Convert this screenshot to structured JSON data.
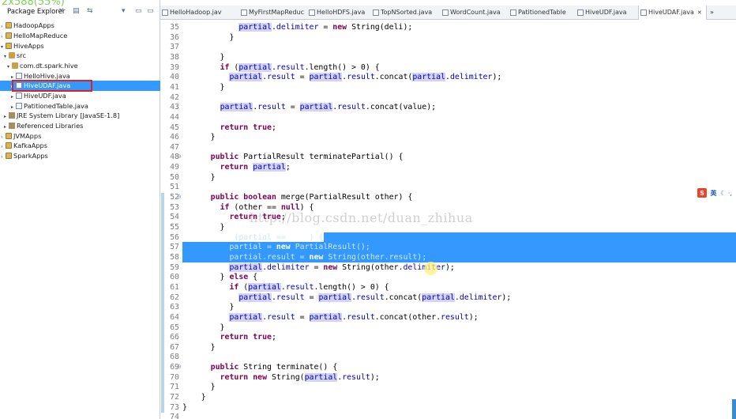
{
  "overlay": {
    "size_label": "2x588(55%)"
  },
  "explorer": {
    "title": "Package Explorer",
    "close": "✕",
    "toolbar": [
      "▤",
      "⇆",
      "▾",
      "▭",
      "▭"
    ],
    "items": [
      {
        "label": "HadoopApps",
        "kind": "project"
      },
      {
        "label": "HelloMapReduce",
        "kind": "project"
      },
      {
        "label": "HiveApps",
        "kind": "project"
      },
      {
        "label": "src",
        "kind": "src"
      },
      {
        "label": "com.dt.spark.hive",
        "kind": "package"
      },
      {
        "label": "HelloHive.java",
        "kind": "java"
      },
      {
        "label": "HiveUDAF.java",
        "kind": "java"
      },
      {
        "label": "HiveUDF.java",
        "kind": "java"
      },
      {
        "label": "PatitionedTable.java",
        "kind": "java"
      },
      {
        "label": "JRE System Library [JavaSE-1.8]",
        "kind": "lib"
      },
      {
        "label": "Referenced Libraries",
        "kind": "lib"
      },
      {
        "label": "JVMApps",
        "kind": "project"
      },
      {
        "label": "KafkaApps",
        "kind": "project"
      },
      {
        "label": "SparkApps",
        "kind": "project"
      }
    ]
  },
  "tabs": [
    {
      "label": "HelloHadoop.jav"
    },
    {
      "label": "MyFirstMapReduc"
    },
    {
      "label": "HelloHDFS.java"
    },
    {
      "label": "TopNSorted.java"
    },
    {
      "label": "WordCount.java"
    },
    {
      "label": "PatitionedTable"
    },
    {
      "label": "HiveUDF.java"
    },
    {
      "label": "HiveUDAF.java"
    },
    {
      "label": "»"
    }
  ],
  "editor": {
    "lines": [
      {
        "n": "35",
        "code": "            partial.delimiter = new String(deli);"
      },
      {
        "n": "36",
        "code": "          }"
      },
      {
        "n": "37",
        "code": ""
      },
      {
        "n": "38",
        "code": "        }"
      },
      {
        "n": "39",
        "code": "        if (partial.result.length() > 0) {"
      },
      {
        "n": "40",
        "code": "          partial.result = partial.result.concat(partial.delimiter);"
      },
      {
        "n": "41",
        "code": "        }"
      },
      {
        "n": "42",
        "code": ""
      },
      {
        "n": "43",
        "code": "        partial.result = partial.result.concat(value);"
      },
      {
        "n": "44",
        "code": ""
      },
      {
        "n": "45",
        "code": "        return true;"
      },
      {
        "n": "46",
        "code": "      }"
      },
      {
        "n": "47",
        "code": ""
      },
      {
        "n": "48",
        "code": "      public PartialResult terminatePartial() {"
      },
      {
        "n": "49",
        "code": "        return partial;"
      },
      {
        "n": "50",
        "code": "      }"
      },
      {
        "n": "51",
        "code": ""
      },
      {
        "n": "52",
        "code": "      public boolean merge(PartialResult other) {"
      },
      {
        "n": "53",
        "code": "        if (other == null) {"
      },
      {
        "n": "54",
        "code": "          return true;"
      },
      {
        "n": "55",
        "code": "        }"
      },
      {
        "n": "56",
        "code": "        if (partial == null) {"
      },
      {
        "n": "57",
        "code": "          partial = new PartialResult();"
      },
      {
        "n": "58",
        "code": "          partial.result = new String(other.result);"
      },
      {
        "n": "59",
        "code": "          partial.delimiter = new String(other.delimiter);"
      },
      {
        "n": "60",
        "code": "        } else {"
      },
      {
        "n": "61",
        "code": "          if (partial.result.length() > 0) {"
      },
      {
        "n": "62",
        "code": "            partial.result = partial.result.concat(partial.delimiter);"
      },
      {
        "n": "63",
        "code": "          }"
      },
      {
        "n": "64",
        "code": "          partial.result = partial.result.concat(other.result);"
      },
      {
        "n": "65",
        "code": "        }"
      },
      {
        "n": "66",
        "code": "        return true;"
      },
      {
        "n": "67",
        "code": "      }"
      },
      {
        "n": "68",
        "code": ""
      },
      {
        "n": "69",
        "code": "      public String terminate() {"
      },
      {
        "n": "70",
        "code": "        return new String(partial.result);"
      },
      {
        "n": "71",
        "code": "      }"
      },
      {
        "n": "72",
        "code": "    }"
      },
      {
        "n": "73",
        "code": "}"
      },
      {
        "n": "74",
        "code": ""
      }
    ],
    "watermark": "http://blog.csdn.net/duan_zhihua"
  },
  "ime": {
    "label": "英"
  }
}
